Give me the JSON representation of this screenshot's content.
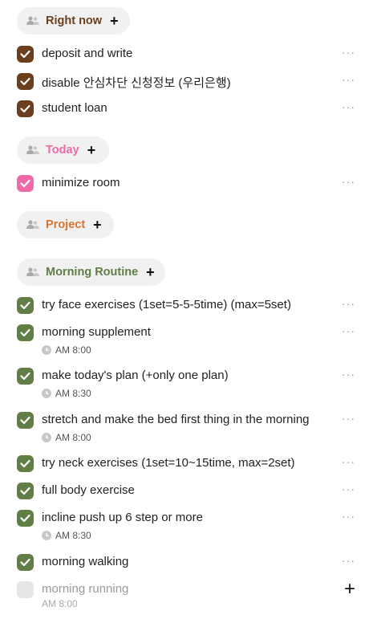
{
  "colors": {
    "brown": "#6b3e1d",
    "pink": "#f06aa9",
    "orange": "#d8742f",
    "green": "#5f7f47",
    "muted": "#e6e6e6"
  },
  "sections": {
    "right_now": {
      "title": "Right now",
      "plus": "+"
    },
    "today": {
      "title": "Today",
      "plus": "+"
    },
    "project": {
      "title": "Project",
      "plus": "+"
    },
    "morning": {
      "title": "Morning Routine",
      "plus": "+"
    }
  },
  "tasks": [
    {
      "label": "deposit and write",
      "more": "···"
    },
    {
      "label": "disable 안심차단 신청정보 (우리은행)",
      "more": "···"
    },
    {
      "label": "student loan",
      "more": "···"
    },
    {
      "label": "minimize room",
      "more": "···"
    },
    {
      "label": "try face exercises (1set=5-5-5time) (max=5set)",
      "more": "···"
    },
    {
      "label": "morning supplement",
      "more": "···",
      "time": "AM 8:00"
    },
    {
      "label": "make today's plan (+only one plan)",
      "more": "···",
      "time": "AM 8:30"
    },
    {
      "label": "stretch and make the bed first thing in the morning",
      "more": "···",
      "time": "AM 8:00"
    },
    {
      "label": "try neck exercises (1set=10~15time, max=2set)",
      "more": "···"
    },
    {
      "label": "full body exercise",
      "more": "···"
    },
    {
      "label": "incline push up 6 step or more",
      "more": "···",
      "time": "AM 8:30"
    },
    {
      "label": "morning walking",
      "more": "···"
    },
    {
      "label": "morning running",
      "time": "AM 8:00"
    }
  ],
  "add_button": "+"
}
